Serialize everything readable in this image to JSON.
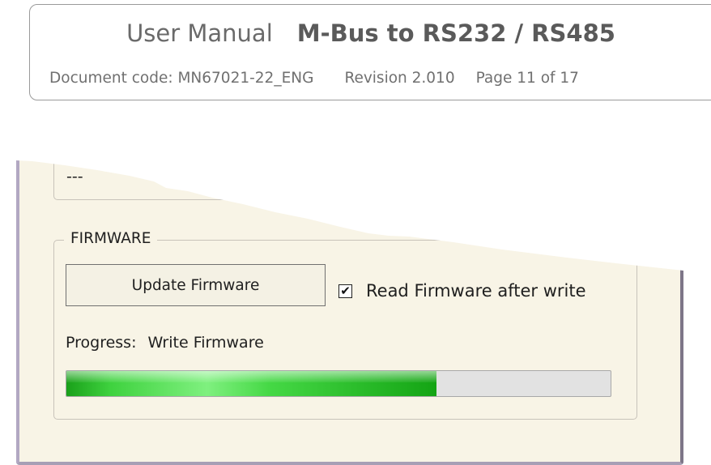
{
  "document": {
    "title_regular": "User Manual",
    "title_bold": "M-Bus to RS232 / RS485",
    "code": "Document code: MN67021-22_ENG",
    "revision": "Revision 2.010",
    "page": "Page 11 of 17"
  },
  "previous_group": {
    "value": "---"
  },
  "firmware": {
    "group_label": "FIRMWARE",
    "update_button_label": "Update Firmware",
    "read_after_write": {
      "label": "Read Firmware after write",
      "checked": true
    },
    "progress_label": "Progress:",
    "progress_status": "Write Firmware",
    "progress_fraction": 0.68
  },
  "colors": {
    "panel": "#f8f4e6",
    "progress_fill": "#2fc22f",
    "window_frame": "#a79fb5"
  }
}
